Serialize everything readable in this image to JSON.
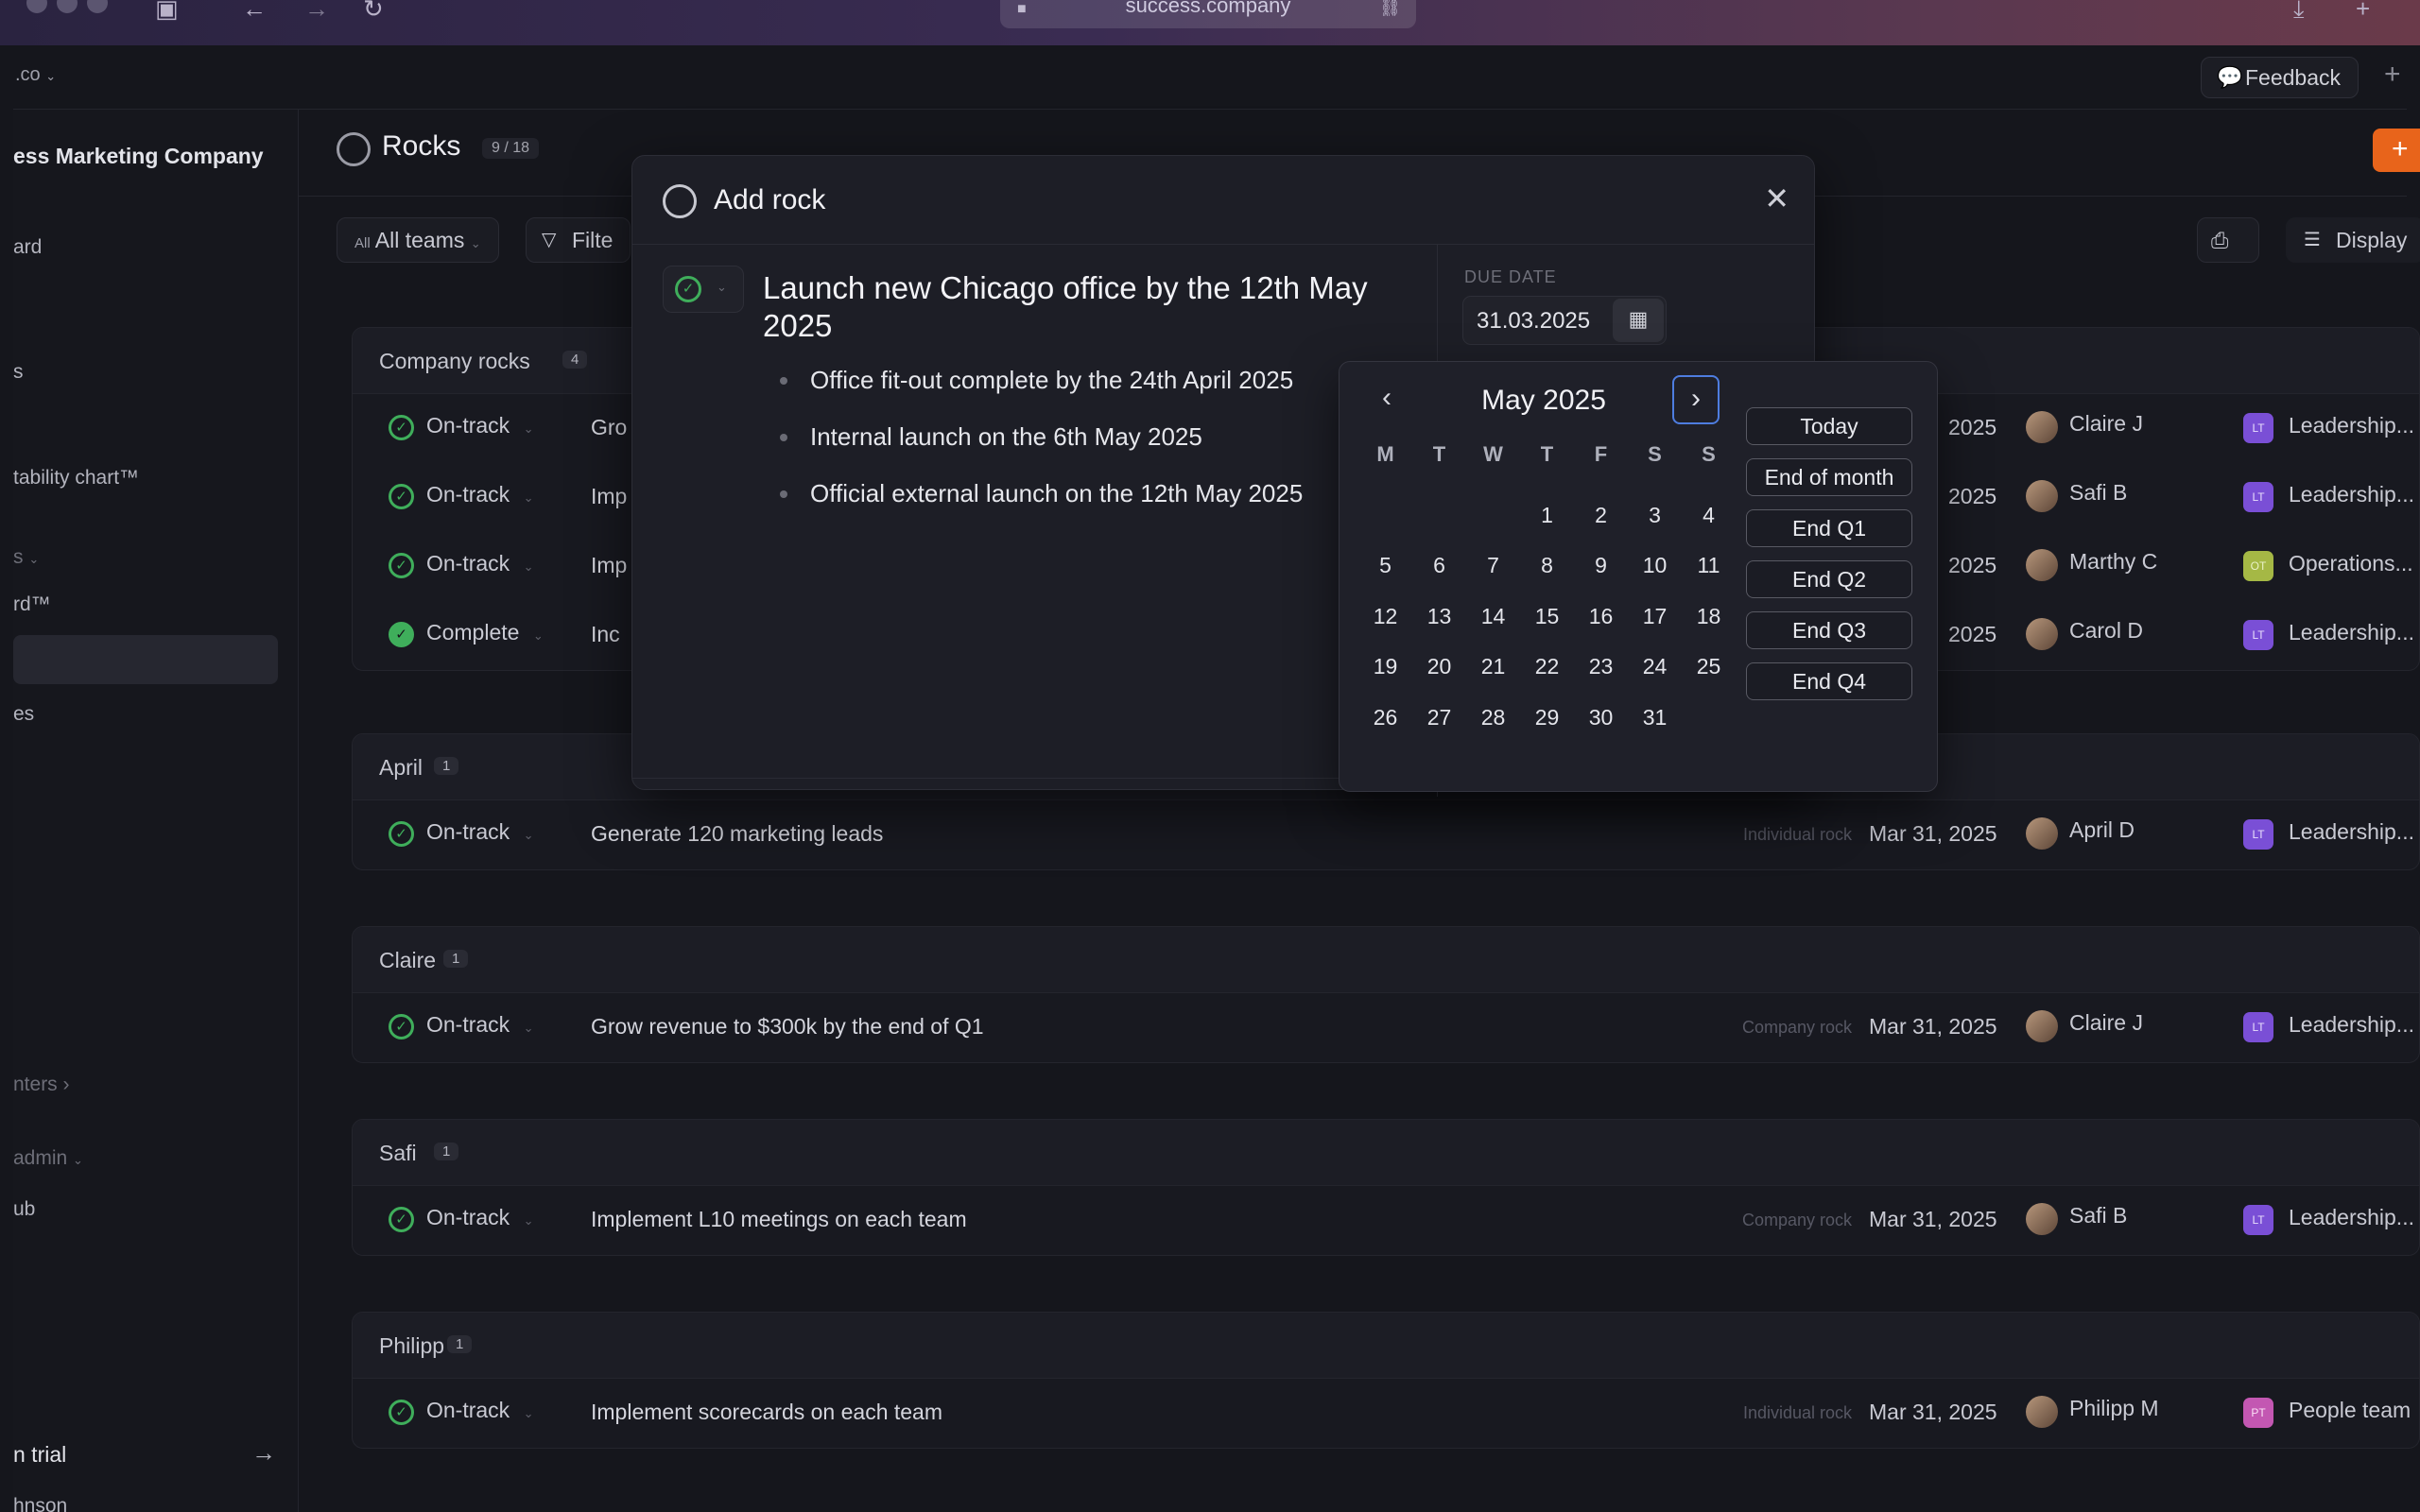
{
  "browser": {
    "url": "success.company"
  },
  "app": {
    "workspace": ".co",
    "feedback_label": "Feedback"
  },
  "sidebar": {
    "company_name": "ess Marketing Company",
    "items": [
      {
        "label": "ard"
      },
      {
        "label": "s"
      },
      {
        "label": "tability chart™"
      },
      {
        "label": "s"
      },
      {
        "label": "rd™"
      },
      {
        "label": "es"
      },
      {
        "label": "nters"
      },
      {
        "label": "admin"
      },
      {
        "label": "ub"
      }
    ],
    "trial_label": "n trial",
    "user_label": "hnson"
  },
  "header": {
    "title": "Rocks",
    "count": "9 / 18",
    "display_label": "Display"
  },
  "filters": {
    "teams_prefix": "All",
    "teams_label": "All teams",
    "filter_label": "Filte"
  },
  "groups": [
    {
      "name": "Company rocks",
      "count": "4",
      "rows": [
        {
          "status": "On-track",
          "title": "Gro",
          "type": "",
          "date": "2025",
          "owner": "Claire J",
          "team_badge": "LT",
          "team": "Leadership..."
        },
        {
          "status": "On-track",
          "title": "Imp",
          "type": "",
          "date": "2025",
          "owner": "Safi B",
          "team_badge": "LT",
          "team": "Leadership..."
        },
        {
          "status": "On-track",
          "title": "Imp",
          "type": "",
          "date": "2025",
          "owner": "Marthy C",
          "team_badge": "OT",
          "team": "Operations..."
        },
        {
          "status": "Complete",
          "title": "Inc",
          "type": "",
          "date": "2025",
          "owner": "Carol D",
          "team_badge": "LT",
          "team": "Leadership..."
        }
      ]
    },
    {
      "name": "April",
      "count": "1",
      "rows": [
        {
          "status": "On-track",
          "title": "Generate 120 marketing leads",
          "type": "Individual rock",
          "date": "Mar 31, 2025",
          "owner": "April D",
          "team_badge": "LT",
          "team": "Leadership..."
        }
      ]
    },
    {
      "name": "Claire",
      "count": "1",
      "rows": [
        {
          "status": "On-track",
          "title": "Grow revenue to $300k by the end of Q1",
          "type": "Company rock",
          "date": "Mar 31, 2025",
          "owner": "Claire J",
          "team_badge": "LT",
          "team": "Leadership..."
        }
      ]
    },
    {
      "name": "Safi",
      "count": "1",
      "rows": [
        {
          "status": "On-track",
          "title": "Implement L10 meetings on each team",
          "type": "Company rock",
          "date": "Mar 31, 2025",
          "owner": "Safi B",
          "team_badge": "LT",
          "team": "Leadership..."
        }
      ]
    },
    {
      "name": "Philipp",
      "count": "1",
      "rows": [
        {
          "status": "On-track",
          "title": "Implement scorecards on each team",
          "type": "Individual rock",
          "date": "Mar 31, 2025",
          "owner": "Philipp M",
          "team_badge": "PT",
          "team": "People team"
        }
      ]
    }
  ],
  "modal": {
    "title": "Add rock",
    "rock_title": "Launch new Chicago office by the 12th May 2025",
    "milestones": [
      "Office fit-out complete by the 24th April 2025",
      "Internal launch on the 6th May 2025",
      "Official external launch on the 12th May 2025"
    ],
    "due_label": "DUE DATE",
    "due_value": "31.03.2025"
  },
  "calendar": {
    "month_label": "May 2025",
    "weekdays": [
      "M",
      "T",
      "W",
      "T",
      "F",
      "S",
      "S"
    ],
    "days": [
      "",
      "",
      "",
      "1",
      "2",
      "3",
      "4",
      "5",
      "6",
      "7",
      "8",
      "9",
      "10",
      "11",
      "12",
      "13",
      "14",
      "15",
      "16",
      "17",
      "18",
      "19",
      "20",
      "21",
      "22",
      "23",
      "24",
      "25",
      "26",
      "27",
      "28",
      "29",
      "30",
      "31",
      ""
    ],
    "quick_options": [
      "Today",
      "End of month",
      "End Q1",
      "End Q2",
      "End Q3",
      "End Q4"
    ]
  }
}
